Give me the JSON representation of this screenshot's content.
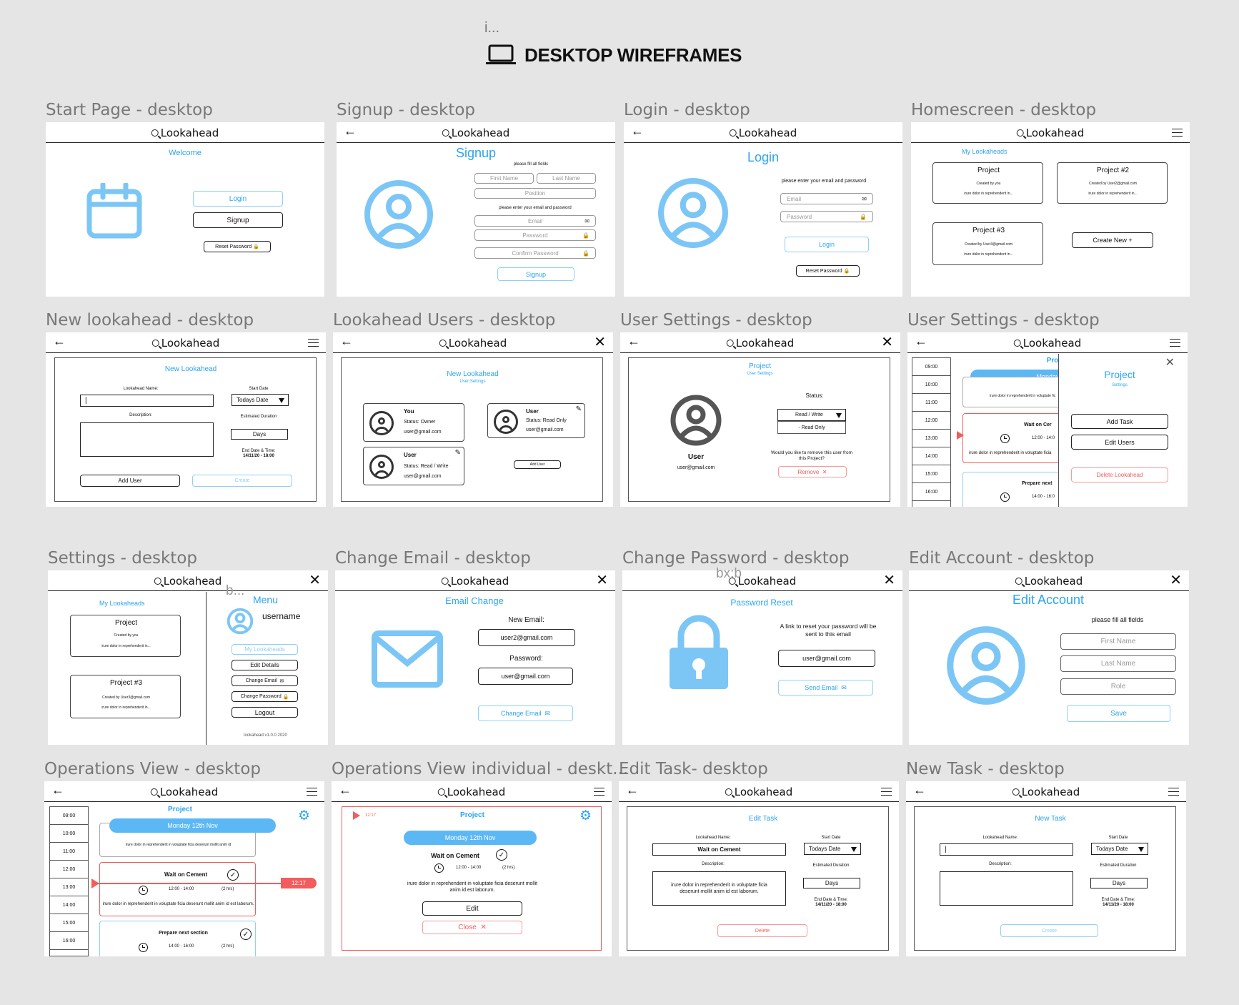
{
  "header": {
    "ellipsis": "i...",
    "title": "DESKTOP WIREFRAMES"
  },
  "brand": "Lookahead",
  "frames": {
    "start": {
      "title": "Start Page - desktop",
      "welcome": "Welcome",
      "login": "Login",
      "signup": "Signup",
      "reset": "Reset Password"
    },
    "signup": {
      "title": "Signup - desktop",
      "heading": "Signup",
      "fill_all": "please fill all fields",
      "first": "First Name",
      "last": "Last Name",
      "position": "Position",
      "enter_email": "please enter your email and password",
      "email": "Email",
      "password": "Password",
      "confirm": "Confirm Password",
      "button": "Signup"
    },
    "login": {
      "title": "Login - desktop",
      "heading": "Login",
      "enter": "please enter your email and password",
      "email": "Email",
      "password": "Password",
      "button": "Login",
      "reset": "Reset Password"
    },
    "home": {
      "title": "Homescreen - desktop",
      "my": "My Lookaheads",
      "cards": [
        {
          "name": "Project",
          "by": "Created by you",
          "desc": "irure dolor in reprehenderit in..."
        },
        {
          "name": "Project #2",
          "by": "Created by User2@gmail.com",
          "desc": "irure dolor in reprehenderit in..."
        },
        {
          "name": "Project #3",
          "by": "Created by User3@gmail.com",
          "desc": "irure dolor in reprehenderit in..."
        }
      ],
      "create": "Create New +"
    },
    "newla": {
      "title": "New lookahead - desktop",
      "heading": "New Lookahead",
      "name_label": "Lookahead Name:",
      "desc_label": "Description:",
      "start": "Start Date",
      "start_val": "Todays Date",
      "est": "Estimated Duration",
      "days": "Days",
      "end": "End Date & Time:",
      "end_val": "14/11/20 - 18:00",
      "add_user": "Add User",
      "create": "Create"
    },
    "users": {
      "title": "Lookahead Users - desktop",
      "heading": "New Lookahead",
      "sub": "User Settings",
      "cards": [
        {
          "name": "You",
          "status": "Status: Owner",
          "email": "user@gmail.com"
        },
        {
          "name": "User",
          "status": "Status: Read Only",
          "email": "user@gmail.com"
        },
        {
          "name": "User",
          "status": "Status: Read / Write",
          "email": "user@gmail.com"
        }
      ],
      "add": "Add User"
    },
    "usettings": {
      "title": "User Settings - desktop",
      "heading": "Project",
      "sub": "User Settings",
      "name": "User",
      "email": "user@gmail.com",
      "status": "Status:",
      "rw": "Read / Write",
      "ro": "- Read Only",
      "question": "Would you like to remove this user from this Project?",
      "remove": "Remove"
    },
    "usettings2": {
      "title": "User Settings - desktop",
      "heading": "Projec",
      "day": "Monday 1",
      "task1": "Wait on Cer",
      "t1time": "12:00 - 14:0",
      "desc": "irure dolor in reprehenderit in voluptate fic",
      "desc2": "irure dolor in reprehenderit in voluptate ficia",
      "task2": "Prepare next",
      "t2time": "14:00 - 16:0",
      "panel_title": "Project",
      "panel_sub": "Settings",
      "add_task": "Add Task",
      "edit_users": "Edit Users",
      "delete": "Delete Lookahead",
      "times": [
        "09:00",
        "10:00",
        "11:00",
        "12:00",
        "13:00",
        "14:00",
        "15:00",
        "16:00"
      ]
    },
    "settings": {
      "title": "Settings - desktop",
      "my": "My Lookaheads",
      "menu": "Menu",
      "username": "username",
      "overlay": "b...",
      "cards": [
        {
          "name": "Project",
          "by": "Created by you",
          "desc": "irure dolor in reprehenderit in..."
        },
        {
          "name": "Project #3",
          "by": "Created by User3@gmail.com",
          "desc": "irure dolor in reprehenderit in..."
        }
      ],
      "my_btn": "My Lookaheads",
      "edit": "Edit Details",
      "change_email": "Change Email",
      "change_pw": "Change Password",
      "logout": "Logout",
      "version": "lookahead v1.0.0 2020"
    },
    "email": {
      "title": "Change Email - desktop",
      "heading": "Email Change",
      "new_label": "New Email:",
      "new_val": "user2@gmail.com",
      "pw_label": "Password:",
      "pw_val": "user@gmail.com",
      "button": "Change Email"
    },
    "password": {
      "title": "Change Password - desktop",
      "overlay": "bx:b",
      "heading": "Password Reset",
      "msg": "A link to reset your password will be sent to this email",
      "email": "user@gmail.com",
      "button": "Send Email"
    },
    "account": {
      "title": "Edit Account - desktop",
      "heading": "Edit Account",
      "fill": "please fill all fields",
      "first": "First Name",
      "last": "Last Name",
      "role": "Role",
      "save": "Save"
    },
    "ops": {
      "title": "Operations View - desktop",
      "heading": "Project",
      "day": "Monday 12th Nov",
      "desc_top": "irure dolor in reprehenderit in voluptate ficia deserunt mollit anim id",
      "task1": "Wait on Cement",
      "t1time": "12:00 - 14:00",
      "t1dur": "(2 hrs)",
      "now": "12:17",
      "desc": "irure dolor in reprehenderit in voluptate ficia deserunt mollit anim id est laborum.",
      "task2": "Prepare next section",
      "t2time": "14:00 - 16:00",
      "t2dur": "(2 hrs)",
      "times": [
        "09:00",
        "10:00",
        "11:00",
        "12:00",
        "13:00",
        "14:00",
        "15:00",
        "16:00"
      ]
    },
    "opsi": {
      "title": "Operations View individual - deskt...",
      "now": "12:17",
      "heading": "Project",
      "day": "Monday 12th Nov",
      "task": "Wait on Cement",
      "time": "12:00 - 14:00",
      "dur": "(2 hrs)",
      "desc": "irure dolor in reprehenderit in voluptate ficia deserunt mollit anim id est laborum.",
      "edit": "Edit",
      "close": "Close"
    },
    "edittask": {
      "title": "Edit Task- desktop",
      "heading": "Edit Task",
      "name_label": "Lookahead Name:",
      "name_val": "Wait on Cement",
      "desc_label": "Description:",
      "desc_val": "irure dolor in reprehenderit in voluptate ficia deserunt mollit anim id est laborum.",
      "start": "Start Date",
      "start_val": "Todays Date",
      "est": "Estimated Duration",
      "days": "Days",
      "end": "End Date & Time:",
      "end_val": "14/11/20 - 18:00",
      "delete": "Delete"
    },
    "newtask": {
      "title": "New Task - desktop",
      "heading": "New Task",
      "name_label": "Lookahead Name:",
      "desc_label": "Description:",
      "start": "Start Date",
      "start_val": "Todays Date",
      "est": "Estimated Duration",
      "days": "Days",
      "end": "End Date & Time:",
      "end_val": "14/11/20 - 18:00",
      "create": "Create"
    }
  },
  "colors": {
    "accent": "#2aa4ee",
    "icon_blue": "#7cc6f6",
    "danger": "#f25c5c",
    "pill": "#5cb8f5"
  }
}
